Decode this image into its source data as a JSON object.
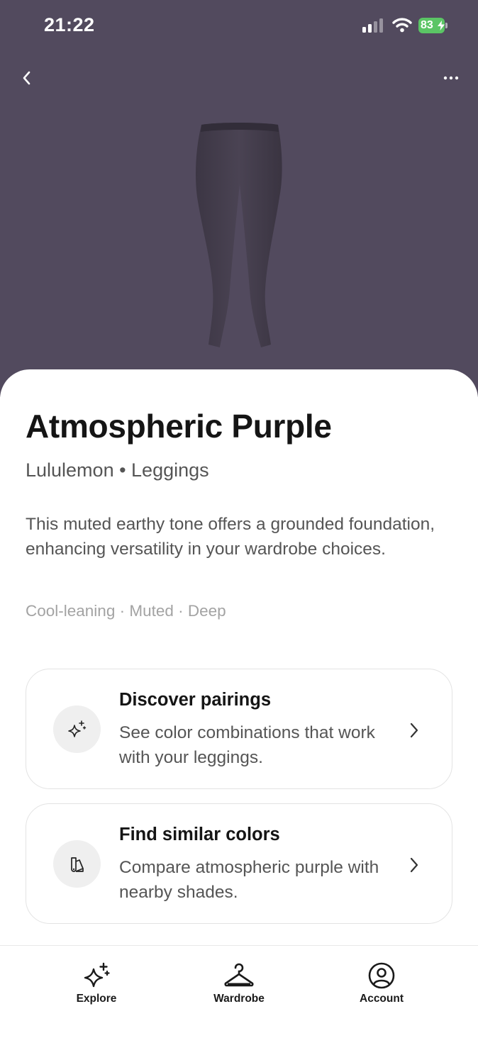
{
  "status_bar": {
    "time": "21:22",
    "battery_level": "83",
    "icons": [
      "signal-icon",
      "wifi-icon",
      "battery-icon",
      "bolt-icon"
    ]
  },
  "header": {
    "icons": [
      "chevron-left-icon",
      "more-horizontal-icon"
    ]
  },
  "hero": {
    "background_color": "#524a5e",
    "image": "leggings-image"
  },
  "product": {
    "name": "Atmospheric Purple",
    "meta": "Lululemon • Leggings",
    "description": "This muted earthy tone offers a grounded foundation, enhancing versatility in your wardrobe choices.",
    "tags": "Cool-leaning · Muted · Deep"
  },
  "cards": [
    {
      "title": "Discover pairings",
      "description": "See color combinations that work with your leggings.",
      "icon": "sparkle-icon"
    },
    {
      "title": "Find similar colors",
      "description": "Compare atmospheric purple with nearby shades.",
      "icon": "swatch-icon"
    }
  ],
  "tabbar": {
    "items": [
      {
        "label": "Explore",
        "icon": "sparkles-icon"
      },
      {
        "label": "Wardrobe",
        "icon": "hanger-icon"
      },
      {
        "label": "Account",
        "icon": "user-circle-icon"
      }
    ]
  },
  "colors": {
    "hero": "#524a5e",
    "battery": "#5bc565",
    "text_primary": "#151515",
    "text_secondary": "#555555",
    "text_tertiary": "#a3a3a3"
  }
}
